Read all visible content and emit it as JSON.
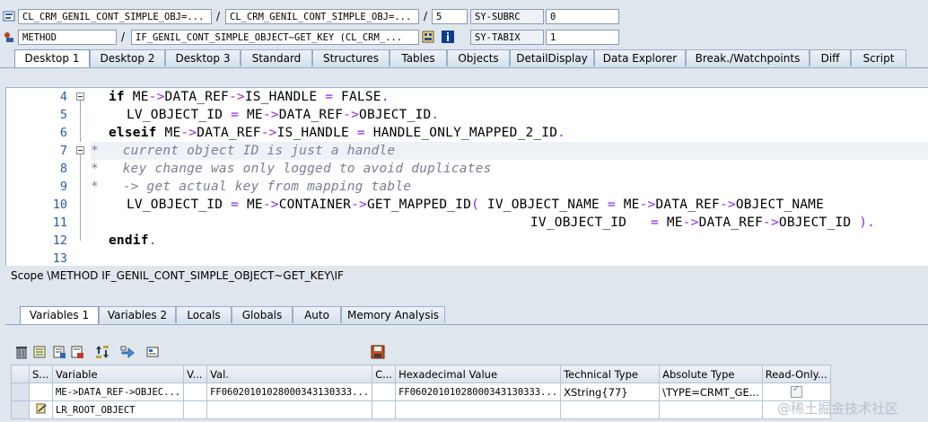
{
  "header": {
    "row1": {
      "program": "CL_CRM_GENIL_CONT_SIMPLE_OBJ=...",
      "include": "CL_CRM_GENIL_CONT_SIMPLE_OBJ=...",
      "line": "5",
      "sysvar_name": "SY-SUBRC",
      "sysvar_value": "0"
    },
    "row2": {
      "event_type": "METHOD",
      "event": "IF_GENIL_CONT_SIMPLE_OBJECT~GET_KEY (CL_CRM_...",
      "sysvar_name": "SY-TABIX",
      "sysvar_value": "1"
    },
    "separator": "/"
  },
  "tabs": [
    "Desktop 1",
    "Desktop 2",
    "Desktop 3",
    "Standard",
    "Structures",
    "Tables",
    "Objects",
    "DetailDisplay",
    "Data Explorer",
    "Break./Watchpoints",
    "Diff",
    "Script"
  ],
  "active_tab": "Desktop 1",
  "code": {
    "line_numbers": [
      "4",
      "5",
      "6",
      "7",
      "8",
      "9",
      "10",
      "11",
      "12",
      "13"
    ],
    "l4_kw": "if",
    "l4_a": " ME",
    "l4_op1": "->",
    "l4_b": "DATA_REF",
    "l4_op2": "->",
    "l4_c": "IS_HANDLE ",
    "l4_op3": "=",
    "l4_d": " FALSE",
    "l4_op4": ".",
    "l5_a": "LV_OBJECT_ID ",
    "l5_op1": "=",
    "l5_b": " ME",
    "l5_op2": "->",
    "l5_c": "DATA_REF",
    "l5_op3": "->",
    "l5_d": "OBJECT_ID",
    "l5_op4": ".",
    "l6_kw": "elseif",
    "l6_a": " ME",
    "l6_op1": "->",
    "l6_b": "DATA_REF",
    "l6_op2": "->",
    "l6_c": "IS_HANDLE ",
    "l6_op3": "=",
    "l6_d": " HANDLE_ONLY_MAPPED_2_ID",
    "l6_op4": ".",
    "l7": "*   current object ID is just a handle",
    "l8": "*   key change was only logged to avoid duplicates",
    "l9": "*   -> get actual key from mapping table",
    "l10_a": "LV_OBJECT_ID ",
    "l10_op1": "=",
    "l10_b": " ME",
    "l10_op2": "->",
    "l10_c": "CONTAINER",
    "l10_op3": "->",
    "l10_d": "GET_MAPPED_ID",
    "l10_op4": "(",
    "l10_e": " IV_OBJECT_NAME ",
    "l10_op5": "=",
    "l10_f": " ME",
    "l10_op6": "->",
    "l10_g": "DATA_REF",
    "l10_op7": "->",
    "l10_h": "OBJECT_NAME",
    "l11_a": "IV_OBJECT_ID   ",
    "l11_op1": "=",
    "l11_b": " ME",
    "l11_op2": "->",
    "l11_c": "DATA_REF",
    "l11_op3": "->",
    "l11_d": "OBJECT_ID ",
    "l11_op4": ").",
    "l12_kw": "endif",
    "l12_op": "."
  },
  "scope_text": "Scope \\METHOD IF_GENIL_CONT_SIMPLE_OBJECT~GET_KEY\\IF",
  "lower_tabs": [
    "Variables 1",
    "Variables 2",
    "Locals",
    "Globals",
    "Auto",
    "Memory Analysis"
  ],
  "active_lower_tab": "Variables 1",
  "toolbar_icons": [
    "delete-icon",
    "variable-list-icon",
    "import-icon",
    "export-icon",
    "swap-icon",
    "navigate-icon",
    "object-icon",
    "save-icon"
  ],
  "table": {
    "columns": [
      "S...",
      "Variable",
      "V...",
      "Val.",
      "C...",
      "Hexadecimal Value",
      "Technical Type",
      "Absolute Type",
      "Read-Only..."
    ],
    "rows": [
      {
        "variable": "ME->DATA_REF->OBJEC...",
        "val": "FF06020101028000343130333...",
        "hex": "FF06020101028000343130333...",
        "tech": "XString{77}",
        "abs": "\\TYPE=CRMT_GE...",
        "readonly": true
      },
      {
        "variable": "LR_ROOT_OBJECT",
        "val": "",
        "hex": "",
        "tech": "",
        "abs": "",
        "readonly": false
      }
    ]
  },
  "watermark": "@稀土掘金技术社区",
  "colors": {
    "keyword": "#000000",
    "operator": "#8a2be2",
    "comment": "#7c7c9a",
    "line_number": "#2a5aa8",
    "accent": "#8fa7c2"
  }
}
